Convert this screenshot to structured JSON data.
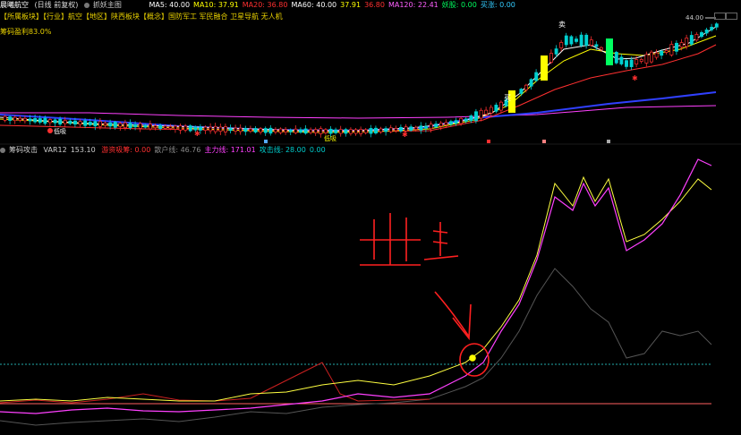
{
  "header": {
    "stock_name": "晨曦航空",
    "period": "(日线 前复权)",
    "indicator_name": "抓妖主图",
    "ma": [
      {
        "label": "MA5",
        "value": "40.00",
        "color": "#ffffff"
      },
      {
        "label": "MA10",
        "value": "37.91",
        "color": "#ffff00"
      },
      {
        "label": "MA20",
        "value": "36.80",
        "color": "#ff3030"
      },
      {
        "label": "MA60",
        "value": "40.00",
        "color": "#ffffff"
      },
      {
        "label": "",
        "value": "37.91",
        "color": "#ffff00"
      },
      {
        "label": "",
        "value": "36.80",
        "color": "#ff3030"
      },
      {
        "label": "MA120",
        "value": "22.41",
        "color": "#ff60ff"
      }
    ],
    "tail": [
      {
        "label": "妖股",
        "value": "0.00",
        "color": "#00ff60"
      },
      {
        "label": "买涨",
        "value": "0.00",
        "color": "#3cf"
      }
    ]
  },
  "concepts": "【所属板块】【行业】航空【地区】陕西板块【概念】国防军工 军民融合 卫星导航 无人机",
  "chip_profit": {
    "label": "筹码盈利",
    "value": "83.0%"
  },
  "price_marker": "44.00",
  "signals": {
    "sell": "卖",
    "buy": "买",
    "low_marker": "低吸"
  },
  "lower": {
    "title": "筹码攻击",
    "var12_label": "VAR12",
    "var12_value": "153.10",
    "items": [
      {
        "label": "游资吸筹",
        "value": "0.00",
        "color": "#ff3030"
      },
      {
        "label": "散户线",
        "value": "46.76",
        "color": "#888888"
      },
      {
        "label": "主力线",
        "value": "171.01",
        "color": "#ff40ff"
      },
      {
        "label": "攻击线",
        "value": "28.00",
        "color": "#00cccc"
      },
      {
        "label": "",
        "value": "0.00",
        "color": "#00cccc"
      }
    ]
  },
  "annotation": {
    "text": "出击"
  }
}
